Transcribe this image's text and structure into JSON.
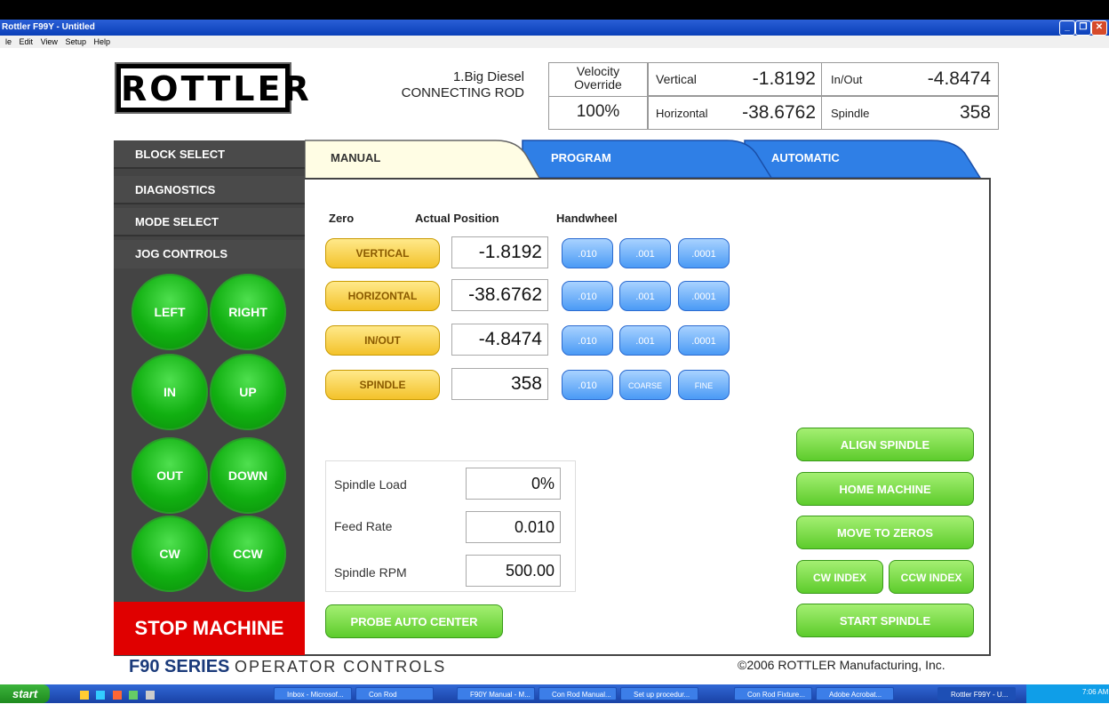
{
  "window": {
    "title": "Rottler F99Y - Untitled"
  },
  "menu": [
    "le",
    "Edit",
    "View",
    "Setup",
    "Help"
  ],
  "header": {
    "logo": "ROTTLER",
    "part_line1": "1.Big Diesel",
    "part_line2": "CONNECTING ROD",
    "velocity_label_1": "Velocity",
    "velocity_label_2": "Override",
    "velocity_value": "100%",
    "vertical_label": "Vertical",
    "vertical_value": "-1.8192",
    "inout_label": "In/Out",
    "inout_value": "-4.8474",
    "horizontal_label": "Horizontal",
    "horizontal_value": "-38.6762",
    "spindle_label": "Spindle",
    "spindle_value": "358"
  },
  "left_menu": [
    "BLOCK SELECT",
    "DIAGNOSTICS",
    "MODE SELECT",
    "JOG CONTROLS"
  ],
  "jog": [
    "LEFT",
    "RIGHT",
    "IN",
    "UP",
    "OUT",
    "DOWN",
    "CW",
    "CCW"
  ],
  "stop_label": "STOP MACHINE",
  "tabs": [
    "MANUAL",
    "PROGRAM",
    "AUTOMATIC"
  ],
  "columns": {
    "zero": "Zero",
    "actual": "Actual Position",
    "handwheel": "Handwheel"
  },
  "axes": [
    {
      "name": "VERTICAL",
      "value": "-1.8192",
      "hw": [
        ".010",
        ".001",
        ".0001"
      ]
    },
    {
      "name": "HORIZONTAL",
      "value": "-38.6762",
      "hw": [
        ".010",
        ".001",
        ".0001"
      ]
    },
    {
      "name": "IN/OUT",
      "value": "-4.8474",
      "hw": [
        ".010",
        ".001",
        ".0001"
      ]
    },
    {
      "name": "SPINDLE",
      "value": "358",
      "hw": [
        ".010",
        "COARSE",
        "FINE"
      ]
    }
  ],
  "stats": [
    {
      "label": "Spindle Load",
      "value": "0%"
    },
    {
      "label": "Feed Rate",
      "value": "0.010"
    },
    {
      "label": "Spindle RPM",
      "value": "500.00"
    }
  ],
  "probe_label": "PROBE AUTO CENTER",
  "actions": {
    "align": "ALIGN SPINDLE",
    "home": "HOME MACHINE",
    "zeros": "MOVE TO ZEROS",
    "cw_index": "CW INDEX",
    "ccw_index": "CCW INDEX",
    "start": "START SPINDLE"
  },
  "footer": {
    "series": "F90 SERIES",
    "subtitle": "OPERATOR CONTROLS",
    "copyright": "©2006 ROTTLER Manufacturing, Inc."
  },
  "taskbar": {
    "start": "start",
    "tasks": [
      "Inbox - Microsof...",
      "Con Rod",
      "F90Y Manual - M...",
      "Con Rod Manual...",
      "Set up procedur...",
      "Con Rod Fixture...",
      "Adobe Acrobat...",
      "Rottler F99Y - U..."
    ],
    "clock": "7:06 AM"
  },
  "colors": {
    "stop": "#e00000",
    "jog_green": "#11b011",
    "tab_blue": "#2f7fe6",
    "zero_yellow": "#f3c22a"
  }
}
